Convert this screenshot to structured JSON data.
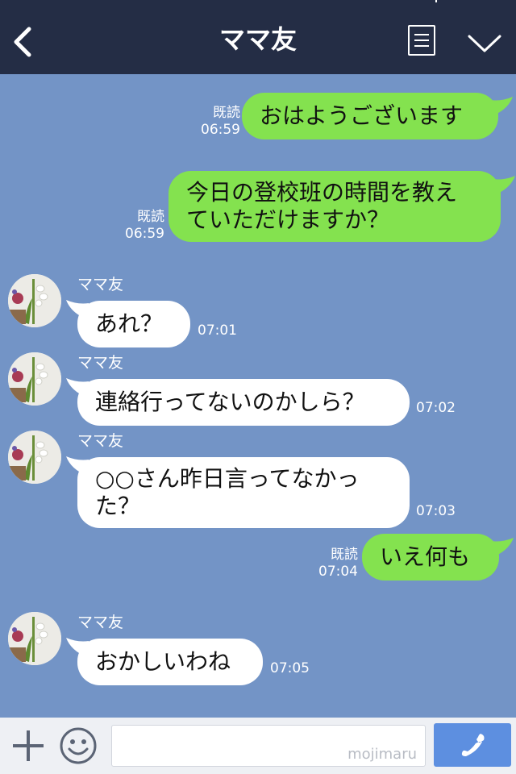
{
  "header": {
    "title": "ママ友",
    "back_icon": "chevron-left-icon",
    "menu_icon": "list-icon",
    "expand_icon": "chevron-down-icon",
    "background": "#242d45"
  },
  "chat": {
    "background": "#7394c6",
    "sent_bubble_color": "#84e24f",
    "received_bubble_color": "#ffffff",
    "messages": [
      {
        "direction": "sent",
        "lines": [
          "おはようございます"
        ],
        "read": "既読",
        "time": "06:59"
      },
      {
        "direction": "sent",
        "lines": [
          "今日の登校班の時間を教え",
          "ていただけますか？"
        ],
        "read": "既読",
        "time": "06:59"
      },
      {
        "direction": "received",
        "sender": "ママ友",
        "lines": [
          "あれ？"
        ],
        "time": "07:01"
      },
      {
        "direction": "received",
        "sender": "ママ友",
        "lines": [
          "連絡行ってないのかしら？"
        ],
        "time": "07:02"
      },
      {
        "direction": "received",
        "sender": "ママ友",
        "lines": [
          "○○さん昨日言ってなかっ",
          "た？"
        ],
        "time": "07:03"
      },
      {
        "direction": "sent",
        "lines": [
          "いえ何も"
        ],
        "read": "既読",
        "time": "07:04"
      },
      {
        "direction": "received",
        "sender": "ママ友",
        "lines": [
          "おかしいわね"
        ],
        "time": "07:05"
      }
    ]
  },
  "composer": {
    "plus_icon": "plus-icon",
    "emoji_icon": "smile-icon",
    "input_value": "",
    "watermark": "mojimaru",
    "call_icon": "phone-icon",
    "call_button_color": "#5d8fe0"
  }
}
